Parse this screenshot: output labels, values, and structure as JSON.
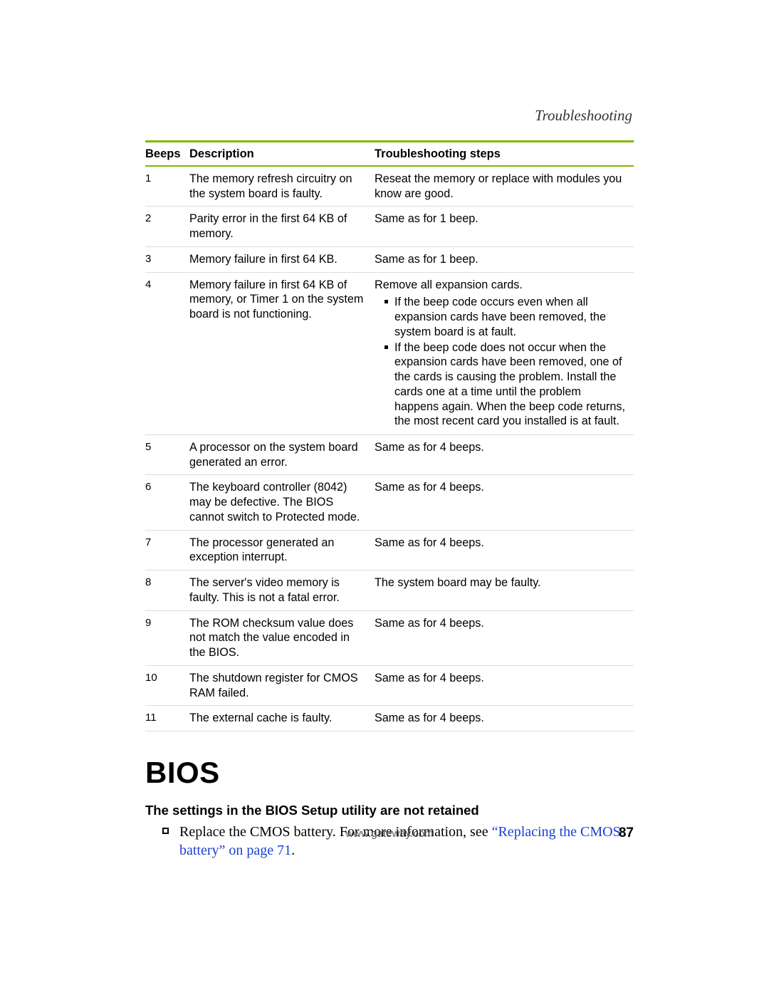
{
  "section_label": "Troubleshooting",
  "table": {
    "headers": {
      "beeps": "Beeps",
      "description": "Description",
      "steps": "Troubleshooting steps"
    },
    "rows": [
      {
        "beeps": "1",
        "description": "The memory refresh circuitry on the system board is faulty.",
        "steps_plain": "Reseat the memory or replace with modules you know are good."
      },
      {
        "beeps": "2",
        "description": "Parity error in the first 64 KB of memory.",
        "steps_plain": "Same as for 1 beep."
      },
      {
        "beeps": "3",
        "description": "Memory failure in first 64 KB.",
        "steps_plain": "Same as for 1 beep."
      },
      {
        "beeps": "4",
        "description": "Memory failure in first 64 KB of memory, or Timer 1 on the system board is not functioning.",
        "steps_lead": "Remove all expansion cards.",
        "steps_list": [
          "If the beep code occurs even when all expansion cards have been removed, the system board is at fault.",
          "If the beep code does not occur when the expansion cards have been removed, one of the cards is causing the problem. Install the cards one at a time until the problem happens again. When the beep code returns, the most recent card you installed is at fault."
        ]
      },
      {
        "beeps": "5",
        "description": "A processor on the system board generated an error.",
        "steps_plain": "Same as for 4 beeps."
      },
      {
        "beeps": "6",
        "description": "The keyboard controller (8042) may be defective. The BIOS cannot switch to Protected mode.",
        "steps_plain": "Same as for 4 beeps."
      },
      {
        "beeps": "7",
        "description": "The processor generated an exception interrupt.",
        "steps_plain": "Same as for 4 beeps."
      },
      {
        "beeps": "8",
        "description": "The server's video memory is faulty. This is not a fatal error.",
        "steps_plain": "The system board may be faulty."
      },
      {
        "beeps": "9",
        "description": "The ROM checksum value does not match the value encoded in the BIOS.",
        "steps_plain": "Same as for 4 beeps."
      },
      {
        "beeps": "10",
        "description": "The shutdown register for CMOS RAM failed.",
        "steps_plain": "Same as for 4 beeps."
      },
      {
        "beeps": "11",
        "description": "The external cache is faulty.",
        "steps_plain": "Same as for 4 beeps."
      }
    ]
  },
  "heading": "BIOS",
  "subheading": "The settings in the BIOS Setup utility are not retained",
  "body_bullet": {
    "prefix": "Replace the CMOS battery. For more information, see ",
    "link_text": "“Replacing the CMOS battery” on page 71",
    "suffix": "."
  },
  "footer": {
    "url": "www.gateway.com",
    "page_number": "87"
  }
}
